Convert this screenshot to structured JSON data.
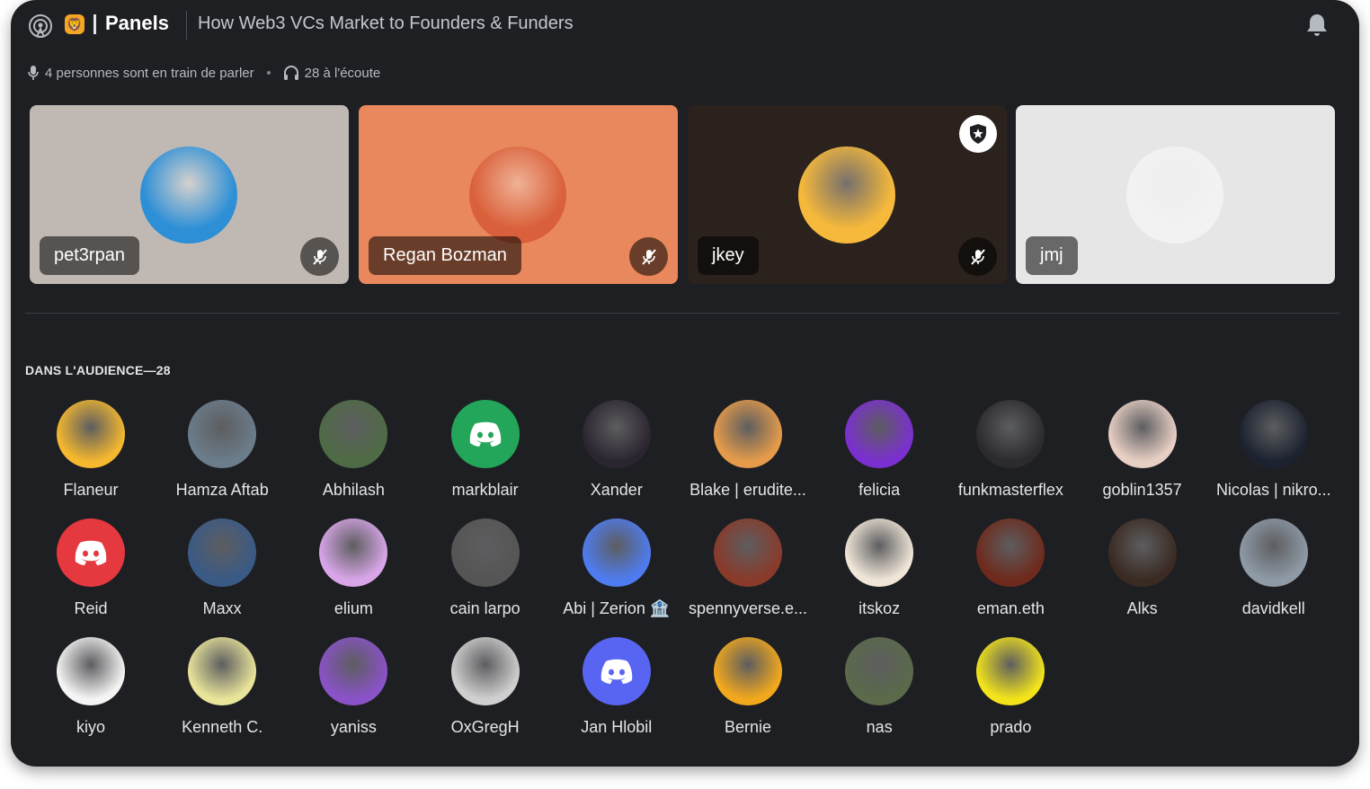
{
  "header": {
    "server_emoji": "🦁",
    "channel": "Panels",
    "topic": "How Web3 VCs Market to Founders & Funders"
  },
  "stats": {
    "speaking": "4 personnes sont en train de parler",
    "listening": "28 à l'écoute"
  },
  "speakers": [
    {
      "name": "pet3rpan",
      "bg": "#c0b9b3",
      "avatar_color": "#2d8fd6",
      "muted": true,
      "moderator": false
    },
    {
      "name": "Regan Bozman",
      "bg": "#e8885c",
      "avatar_color": "#d9603a",
      "muted": true,
      "moderator": false
    },
    {
      "name": "jkey",
      "bg": "#2b221e",
      "avatar_color": "#f6b93b",
      "muted": true,
      "moderator": true
    },
    {
      "name": "jmj",
      "bg": "#e6e6e6",
      "avatar_color": "#f2f2f2",
      "muted": false,
      "moderator": false
    }
  ],
  "audience": {
    "title": "DANS L'AUDIENCE—28",
    "members": [
      {
        "name": "Flaneur",
        "color": "#f5b82e",
        "icon": "cow-avatar-icon"
      },
      {
        "name": "Hamza Aftab",
        "color": "#6b7c8a",
        "icon": "person-photo-icon"
      },
      {
        "name": "Abhilash",
        "color": "#4f6b45",
        "icon": "person-photo-icon"
      },
      {
        "name": "markblair",
        "color": "#23a55a",
        "icon": "discord-logo-icon"
      },
      {
        "name": "Xander",
        "color": "#2b2530",
        "icon": "hooded-figure-icon"
      },
      {
        "name": "Blake | erudite...",
        "color": "#e59b4a",
        "icon": "avatar-icon"
      },
      {
        "name": "felicia",
        "color": "#7b2fd0",
        "icon": "pixel-cat-icon"
      },
      {
        "name": "funkmasterflex",
        "color": "#2b2b2e",
        "icon": "astronaut-icon"
      },
      {
        "name": "goblin1357",
        "color": "#e8cfc4",
        "icon": "avatar-icon"
      },
      {
        "name": "Nicolas | nikro...",
        "color": "#1c2230",
        "icon": "wizard-hat-icon"
      },
      {
        "name": "Reid",
        "color": "#e5383f",
        "icon": "discord-logo-icon"
      },
      {
        "name": "Maxx",
        "color": "#3a5a86",
        "icon": "eye-avatar-icon"
      },
      {
        "name": "elium",
        "color": "#d8a6e8",
        "icon": "avatar-icon"
      },
      {
        "name": "cain larpo",
        "color": "#555555",
        "icon": "avatar-icon"
      },
      {
        "name": "Abi | Zerion 🏦",
        "color": "#4e7cf0",
        "icon": "pixel-person-icon"
      },
      {
        "name": "spennyverse.e...",
        "color": "#8a3a2a",
        "icon": "pixel-scene-icon"
      },
      {
        "name": "itskoz",
        "color": "#f0e6d8",
        "icon": "cat-avatar-icon"
      },
      {
        "name": "eman.eth",
        "color": "#6e2a1c",
        "icon": "avatar-icon"
      },
      {
        "name": "Alks",
        "color": "#3a2a22",
        "icon": "avatar-icon"
      },
      {
        "name": "davidkell",
        "color": "#8e9aa6",
        "icon": "person-photo-icon"
      },
      {
        "name": "kiyo",
        "color": "#f4f4f4",
        "icon": "avatar-icon"
      },
      {
        "name": "Kenneth C.",
        "color": "#e8e49a",
        "icon": "avatar-icon"
      },
      {
        "name": "yaniss",
        "color": "#8a52c8",
        "icon": "avatar-icon"
      },
      {
        "name": "OxGregH",
        "color": "#cfcfcf",
        "icon": "person-photo-icon"
      },
      {
        "name": "Jan Hlobil",
        "color": "#5865f2",
        "icon": "discord-logo-icon"
      },
      {
        "name": "Bernie",
        "color": "#f2a81d",
        "icon": "pixel-person-icon"
      },
      {
        "name": "nas",
        "color": "#5a6a4a",
        "icon": "person-photo-icon"
      },
      {
        "name": "prado",
        "color": "#f2e31b",
        "icon": "person-photo-icon"
      }
    ]
  }
}
